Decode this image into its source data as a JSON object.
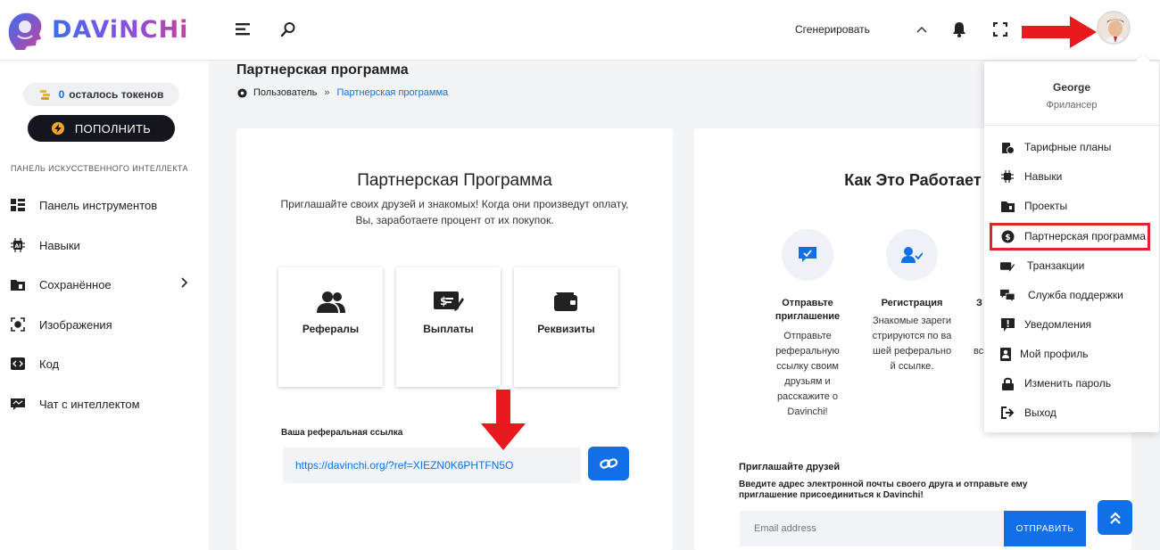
{
  "brand": {
    "name": "DAViNCHi"
  },
  "topbar": {
    "generate_label": "Сгенерировать"
  },
  "sidebar": {
    "tokens_count": "0",
    "tokens_text": "осталось токенов",
    "topup_label": "ПОПОЛНИТЬ",
    "section_title": "ПАНЕЛЬ ИСКУССТВЕННОГО ИНТЕЛЛЕКТА",
    "items": [
      {
        "label": "Панель инструментов",
        "icon": "dashboard-icon"
      },
      {
        "label": "Навыки",
        "icon": "ai-chip-icon"
      },
      {
        "label": "Сохранённое",
        "icon": "folder-icon"
      },
      {
        "label": "Изображения",
        "icon": "image-icon"
      },
      {
        "label": "Код",
        "icon": "code-icon"
      },
      {
        "label": "Чат с интеллектом",
        "icon": "chat-icon"
      }
    ]
  },
  "page": {
    "title": "Партнерская программа",
    "breadcrumb": {
      "root": "Пользователь",
      "separator": "»",
      "current": "Партнерская программа"
    }
  },
  "partner_card": {
    "title": "Партнерская Программа",
    "desc_line1": "Приглашайте своих друзей и знакомых! Когда они произведут оплату,",
    "desc_line2": "Вы, заработаете процент от их покупок.",
    "tiles": [
      {
        "label": "Рефералы",
        "icon": "users-icon"
      },
      {
        "label": "Выплаты",
        "icon": "payout-icon"
      },
      {
        "label": "Реквизиты",
        "icon": "wallet-icon"
      }
    ],
    "ref_label": "Ваша реферальная ссылка",
    "ref_link": "https://davinchi.org/?ref=XIEZN0K6PHTFN5O"
  },
  "how_card": {
    "title": "Как Это Работает",
    "steps": [
      {
        "title_line1": "Отправьте",
        "title_line2": "приглашение",
        "desc": "Отправьте реферальную ссылку своим друзьям и расскажите о Davinchi!"
      },
      {
        "title_line1": "Регистрация",
        "title_line2": "",
        "desc": "Знакомые зарегистрируются по вашей реферальной ссылке."
      }
    ],
    "step3_fragment": "З",
    "step3_desc_fragment": "вс",
    "invite_title": "Приглашайте друзей",
    "invite_desc": "Введите адрес электронной почты своего друга и отправьте ему приглашение присоединиться к Davinchi!",
    "email_placeholder": "Email address",
    "send_label": "ОТПРАВИТЬ"
  },
  "dropdown": {
    "user_name": "George",
    "user_role": "Фрилансер",
    "items": [
      {
        "label": "Тарифные планы",
        "icon": "plans-icon"
      },
      {
        "label": "Навыки",
        "icon": "cpu-icon"
      },
      {
        "label": "Проекты",
        "icon": "projects-folder-icon"
      },
      {
        "label": "Партнерская программа",
        "icon": "dollar-badge-icon"
      },
      {
        "label": "Транзакции",
        "icon": "transactions-icon"
      },
      {
        "label": "Служба поддержки",
        "icon": "support-icon"
      },
      {
        "label": "Уведомления",
        "icon": "notification-icon"
      },
      {
        "label": "Мой профиль",
        "icon": "profile-icon"
      },
      {
        "label": "Изменить пароль",
        "icon": "lock-icon"
      },
      {
        "label": "Выход",
        "icon": "logout-icon"
      }
    ]
  },
  "colors": {
    "accent": "#1170e8",
    "highlight": "#e0242a",
    "dark_button": "#15151d"
  }
}
